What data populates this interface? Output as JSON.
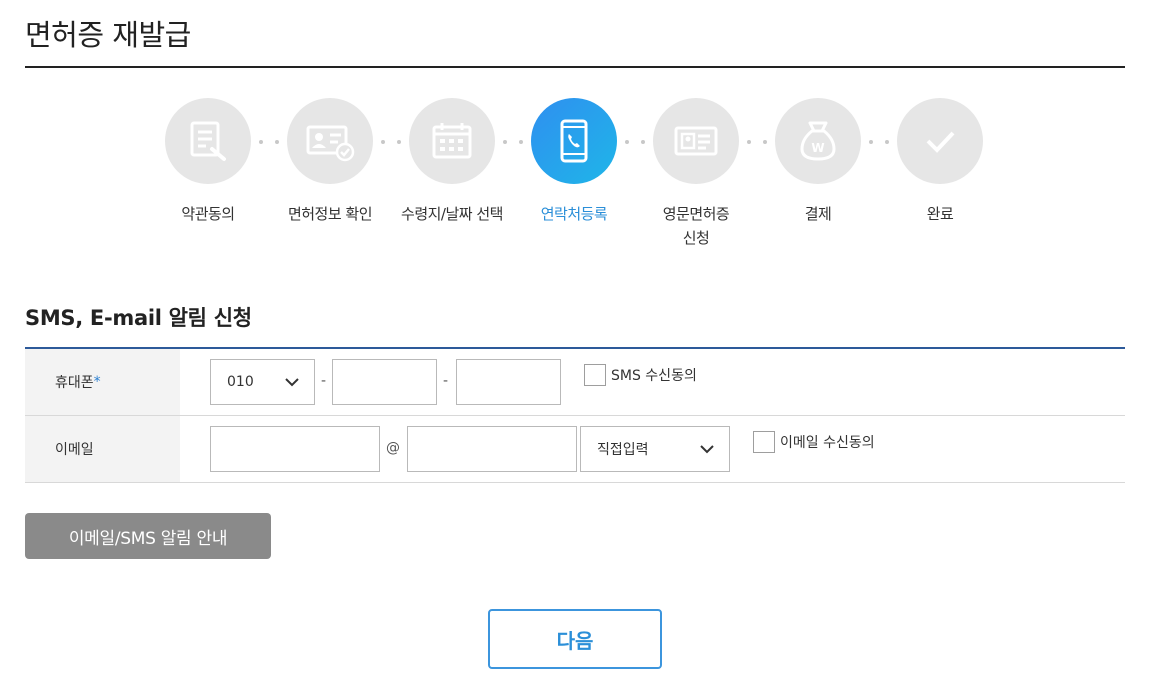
{
  "page": {
    "title": "면허증 재발급"
  },
  "steps": [
    {
      "label": "약관동의",
      "icon": "document-pen-icon",
      "active": false
    },
    {
      "label": "면허정보 확인",
      "icon": "id-card-check-icon",
      "active": false
    },
    {
      "label": "수령지/날짜 선택",
      "icon": "calendar-icon",
      "active": false
    },
    {
      "label": "연락처등록",
      "icon": "smartphone-icon",
      "active": true
    },
    {
      "label": "영문면허증\n신청",
      "icon": "id-card-icon",
      "active": false
    },
    {
      "label": "결제",
      "icon": "money-bag-icon",
      "active": false
    },
    {
      "label": "완료",
      "icon": "checkmark-icon",
      "active": false
    }
  ],
  "section": {
    "title": "SMS, E-mail 알림 신청"
  },
  "phone": {
    "label": "휴대폰",
    "required_mark": "*",
    "prefix_value": "010",
    "separator": "-",
    "middle_value": "",
    "last_value": "",
    "consent_label": "SMS 수신동의"
  },
  "email": {
    "label": "이메일",
    "id_value": "",
    "at_sign": "@",
    "domain_value": "",
    "domain_select": "직접입력",
    "consent_label": "이메일 수신동의"
  },
  "buttons": {
    "guide": "이메일/SMS 알림 안내",
    "next": "다음"
  },
  "colors": {
    "active_step": "#2b8fd8",
    "inactive_step": "#e6e6e6",
    "table_border": "#2d5a9a",
    "guide_button": "#8a8a8a"
  }
}
